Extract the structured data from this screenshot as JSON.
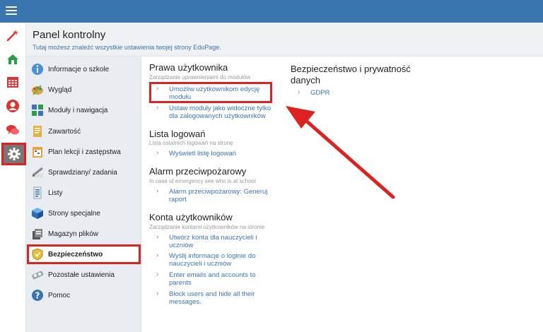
{
  "header": {
    "title": "Panel kontrolny",
    "subtitle": "Tutaj możesz znaleźć wszystkie ustawienia twojej strony EduPage."
  },
  "rail": {
    "icons": [
      "magic-wand-icon",
      "home-icon",
      "calendar-icon",
      "user-icon",
      "chat-icon",
      "gear-icon"
    ],
    "active": "gear-icon"
  },
  "sidebar": {
    "items": [
      {
        "label": "Informacje o szkole",
        "icon": "info-icon"
      },
      {
        "label": "Wygląd",
        "icon": "palette-icon"
      },
      {
        "label": "Moduły i nawigacja",
        "icon": "modules-icon"
      },
      {
        "label": "Zawartość",
        "icon": "content-icon"
      },
      {
        "label": "Plan lekcji i zastępstwa",
        "icon": "timetable-icon"
      },
      {
        "label": "Sprawdziany/ zadania",
        "icon": "pencil-icon"
      },
      {
        "label": "Listy",
        "icon": "list-icon"
      },
      {
        "label": "Strony specjalne",
        "icon": "cube-icon"
      },
      {
        "label": "Magazyn plików",
        "icon": "files-icon"
      },
      {
        "label": "Bezpieczeństwo",
        "icon": "shield-icon"
      },
      {
        "label": "Pozostałe ustawienia",
        "icon": "settings-icon"
      },
      {
        "label": "Pomoc",
        "icon": "help-icon"
      }
    ],
    "active_index": 9
  },
  "sections": {
    "prawa": {
      "title": "Prawa użytkownika",
      "sub": "Zarządzanie uprawnieniami do modułów",
      "links": [
        {
          "line1": "Umożliw użytkownikom edycję",
          "line2": "modułu"
        },
        {
          "line1": "Ustaw moduły jako widoczne tylko",
          "line2": "dla zalogowanych użytkowników"
        }
      ]
    },
    "lista": {
      "title": "Lista logowań",
      "sub": "Lista ostatnich logowań na stronę",
      "links": [
        {
          "line1": "Wyświetl listę logowań"
        }
      ]
    },
    "alarm": {
      "title": "Alarm przeciwpożarowy",
      "sub": "In case of emergency see who is at school",
      "links": [
        {
          "line1": "Alarm przeciwpożarowy: Generuj",
          "line2": "raport"
        }
      ]
    },
    "konta": {
      "title": "Konta użytkowników",
      "sub": "Zarządzanie kontami użytkowników na stronie",
      "links": [
        {
          "line1": "Utwórz konta dla nauczycieli i",
          "line2": "uczniów"
        },
        {
          "line1": "Wyślij informacje o loginie do",
          "line2": "nauczycieli i uczniów"
        },
        {
          "line1": "Enter emails and accounts to",
          "line2": "parents"
        },
        {
          "line1": "Block users and hide all their",
          "line2": "messages."
        }
      ]
    },
    "bezp": {
      "title_line1": "Bezpieczeństwo i prywatność",
      "title_line2": "danych",
      "links": [
        {
          "line1": "GDPR"
        }
      ]
    }
  },
  "colors": {
    "topbar": "#3a75b0",
    "link": "#3a75b0",
    "highlight": "#dd2222"
  }
}
